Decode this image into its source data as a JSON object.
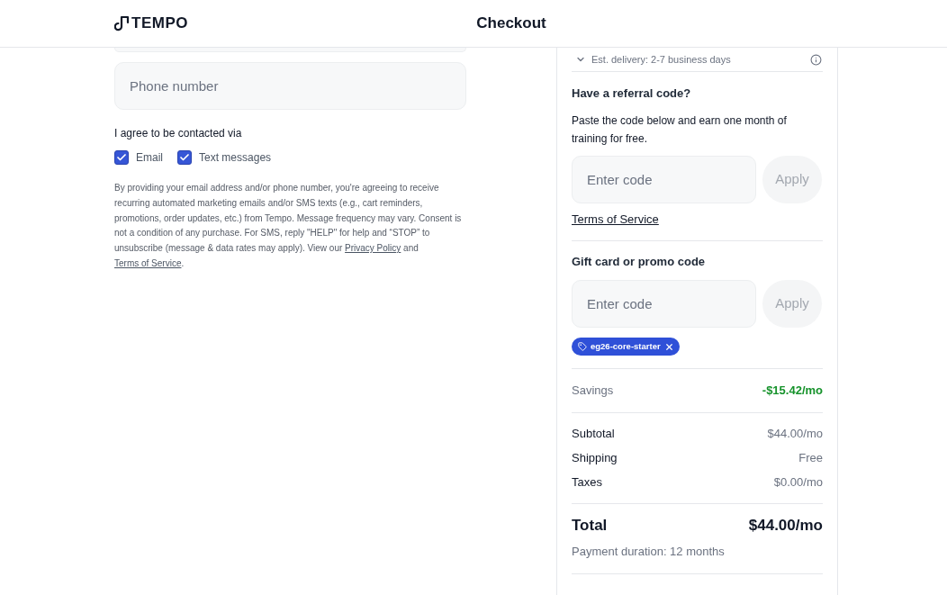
{
  "header": {
    "logo": "TEMPO",
    "title": "Checkout"
  },
  "contact_form": {
    "phone_field": {
      "placeholder": "Phone number"
    },
    "consent_label": "I agree to be contacted via",
    "channels": [
      {
        "label": "Email",
        "checked": true
      },
      {
        "label": "Text messages",
        "checked": true
      }
    ],
    "disclaimer": [
      {
        "kind": "text",
        "text": "By providing your email address and/or phone number, you're agreeing to receive recurring automated marketing emails and/or SMS texts (e.g., cart reminders, promotions, order updates, etc.) from Tempo. Message frequency may vary. Consent is not a condition of any purchase. For SMS, reply \"HELP\" for help and “STOP” to unsubscribe (message & data rates may apply). View our "
      },
      {
        "kind": "link",
        "text": "Privacy Policy"
      },
      {
        "kind": "text",
        "text": " and "
      },
      {
        "kind": "link",
        "text": "Terms of Service"
      },
      {
        "kind": "text",
        "text": "."
      }
    ]
  },
  "order_summary": {
    "delivery": "Est. delivery: 2-7 business days",
    "referral": {
      "heading": "Have a referral code?",
      "description": "Paste the code below and earn one month of training for free.",
      "input": {
        "placeholder": "Enter code"
      },
      "apply_button": {
        "label": "Apply",
        "disabled": true
      },
      "terms_link": "Terms of Service"
    },
    "promo": {
      "heading": "Gift card or promo code",
      "input": {
        "placeholder": "Enter code"
      },
      "apply_button": {
        "label": "Apply",
        "disabled": true
      },
      "applied_codes": [
        "eg26-core-starter"
      ]
    },
    "savings": {
      "label": "Savings",
      "value": "-$15.42/mo"
    },
    "lines": [
      {
        "label": "Subtotal",
        "value": "$44.00/mo"
      },
      {
        "label": "Shipping",
        "value": "Free"
      },
      {
        "label": "Taxes",
        "value": "$0.00/mo"
      }
    ],
    "total": {
      "label": "Total",
      "value": "$44.00/mo"
    },
    "payment_duration": "Payment duration: 12 months"
  }
}
